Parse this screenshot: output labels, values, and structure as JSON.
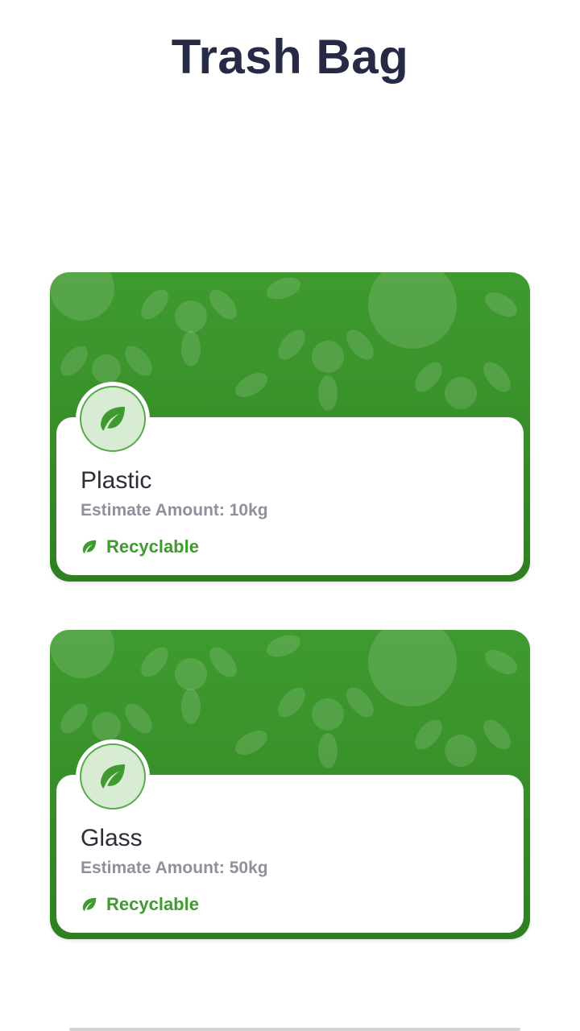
{
  "header": {
    "title": "Trash Bag"
  },
  "items": [
    {
      "name": "Plastic",
      "estimate": "Estimate Amount: 10kg",
      "tag": "Recyclable",
      "tag_icon": "leaf-icon"
    },
    {
      "name": "Glass",
      "estimate": "Estimate Amount: 50kg",
      "tag": "Recyclable",
      "tag_icon": "leaf-icon"
    }
  ],
  "colors": {
    "accent": "#3f9a30",
    "title": "#262a45",
    "card_green": "#3a922b"
  }
}
